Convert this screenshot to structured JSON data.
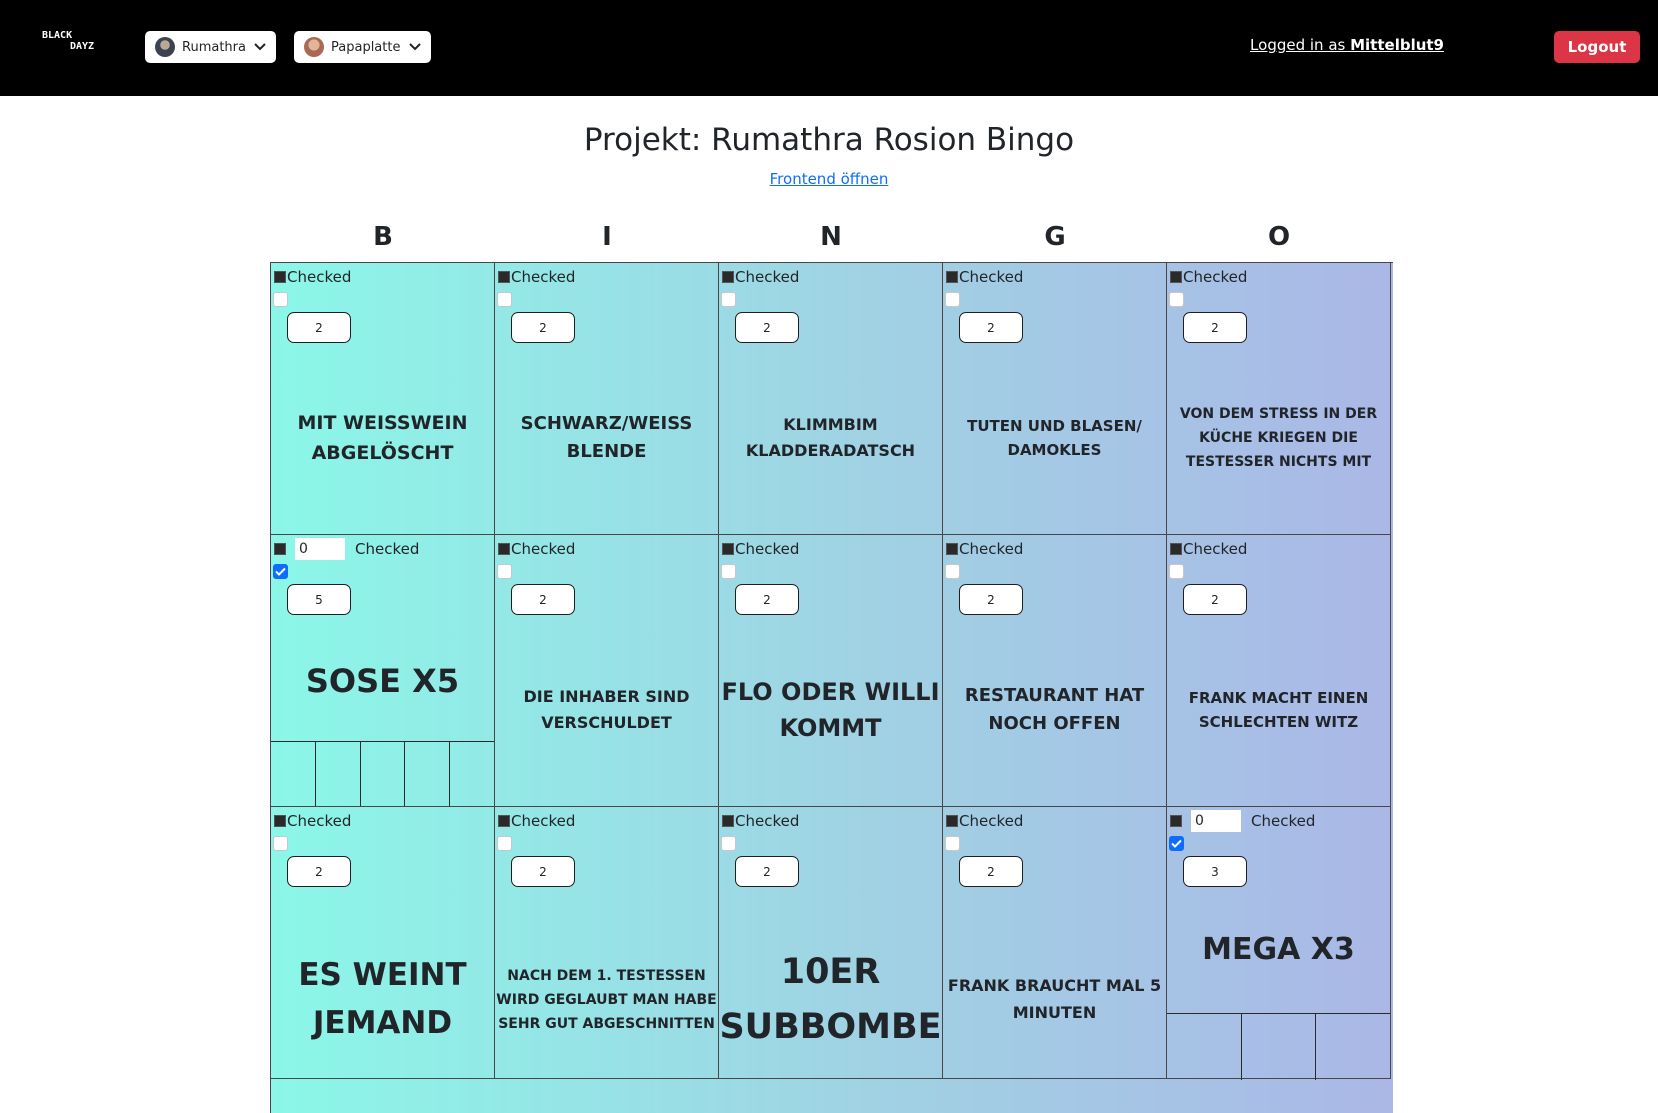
{
  "header": {
    "logo_line1": "BLACK",
    "logo_line2": "DAYZ",
    "user_select_1": {
      "label": "Rumathra"
    },
    "user_select_2": {
      "label": "Papaplatte"
    },
    "login_prefix": "Logged in as ",
    "login_user": "Mittelblut9",
    "logout_label": "Logout"
  },
  "page": {
    "title": "Projekt: Rumathra Rosion Bingo",
    "frontend_link": "Frontend öffnen"
  },
  "letters": [
    "B",
    "I",
    "N",
    "G",
    "O"
  ],
  "cells": [
    {
      "checked_label": "Checked",
      "checked": false,
      "count": "2",
      "text": "MIT WEISSWEIN ABGELÖSCHT"
    },
    {
      "checked_label": "Checked",
      "checked": false,
      "count": "2",
      "text": "SCHWARZ/WEISS BLENDE"
    },
    {
      "checked_label": "Checked",
      "checked": false,
      "count": "2",
      "text": "KLIMMBIM KLADDERADATSCH"
    },
    {
      "checked_label": "Checked",
      "checked": false,
      "count": "2",
      "text": "TUTEN UND BLASEN/ DAMOKLES"
    },
    {
      "checked_label": "Checked",
      "checked": false,
      "count": "2",
      "text": "VON DEM STRESS IN DER KÜCHE KRIEGEN DIE TESTESSER NICHTS MIT"
    },
    {
      "checked_label": "Checked",
      "checked": true,
      "count_input": "0",
      "count": "5",
      "text": "SOSE X5",
      "tally_slots": 5
    },
    {
      "checked_label": "Checked",
      "checked": false,
      "count": "2",
      "text": "DIE INHABER SIND VERSCHULDET"
    },
    {
      "checked_label": "Checked",
      "checked": false,
      "count": "2",
      "text": "FLO ODER WILLI KOMMT"
    },
    {
      "checked_label": "Checked",
      "checked": false,
      "count": "2",
      "text": "RESTAURANT HAT NOCH OFFEN"
    },
    {
      "checked_label": "Checked",
      "checked": false,
      "count": "2",
      "text": "FRANK MACHT EINEN SCHLECHTEN WITZ"
    },
    {
      "checked_label": "Checked",
      "checked": false,
      "count": "2",
      "text": "ES WEINT JEMAND"
    },
    {
      "checked_label": "Checked",
      "checked": false,
      "count": "2",
      "text": "NACH DEM 1. TESTESSEN WIRD GEGLAUBT MAN HABE SEHR GUT ABGESCHNITTEN"
    },
    {
      "checked_label": "Checked",
      "checked": false,
      "count": "2",
      "text": "10ER SUBBOMBE"
    },
    {
      "checked_label": "Checked",
      "checked": false,
      "count": "2",
      "text": "FRANK BRAUCHT MAL 5 MINUTEN"
    },
    {
      "checked_label": "Checked",
      "checked": true,
      "count_input": "0",
      "count": "3",
      "text": "MEGA X3",
      "tally_slots": 3
    }
  ],
  "colors": {
    "header_bg": "#000000",
    "logout_bg": "#dc3545",
    "link": "#0d6efd",
    "board_left": "#8bf7e8",
    "board_right": "#abb7e6",
    "checkbox_on": "#0d6efd"
  }
}
